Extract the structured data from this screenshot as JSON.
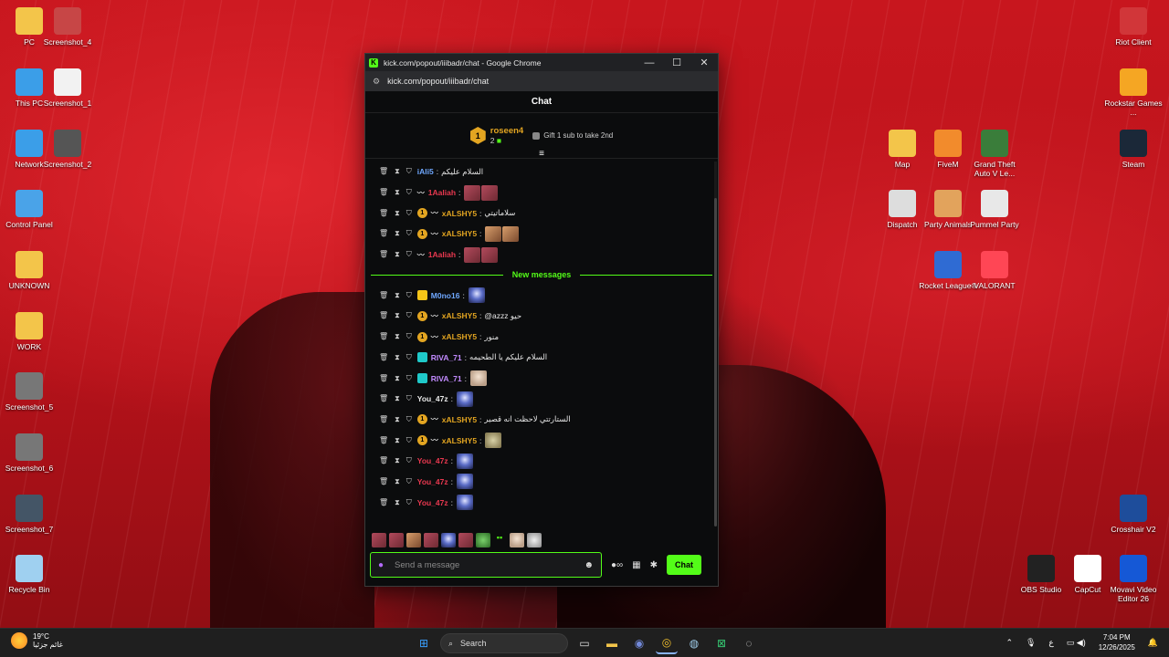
{
  "desktop": {
    "left_icons": [
      {
        "label": "PC",
        "icon": "folder-icon",
        "color": "#f3c54a"
      },
      {
        "label": "Screenshot_4",
        "icon": "image-icon",
        "color": "#c74646"
      },
      {
        "label": "This PC",
        "icon": "monitor-icon",
        "color": "#3b9ee8"
      },
      {
        "label": "Screenshot_1",
        "icon": "document-icon",
        "color": "#f2f2f2"
      },
      {
        "label": "Network",
        "icon": "network-icon",
        "color": "#3b9ee8"
      },
      {
        "label": "Screenshot_2",
        "icon": "image-icon",
        "color": "#555555"
      },
      {
        "label": "Control Panel",
        "icon": "control-panel-icon",
        "color": "#4aa3e8"
      },
      {
        "label": "UNKNOWN",
        "icon": "folder-icon",
        "color": "#f3c54a"
      },
      {
        "label": "WORK",
        "icon": "folder-icon",
        "color": "#f3c54a"
      },
      {
        "label": "Screenshot_5",
        "icon": "image-icon",
        "color": "#777777"
      },
      {
        "label": "Screenshot_6",
        "icon": "image-icon",
        "color": "#777777"
      },
      {
        "label": "Screenshot_7",
        "icon": "image-icon",
        "color": "#445566"
      },
      {
        "label": "Recycle Bin",
        "icon": "recycle-bin-icon",
        "color": "#9fd0f0"
      }
    ],
    "right_icons": [
      {
        "label": "Riot Client",
        "icon": "riot-icon",
        "color": "#d13639"
      },
      {
        "label": "Rockstar Games ...",
        "icon": "rockstar-icon",
        "color": "#f5a623"
      },
      {
        "label": "Steam",
        "icon": "steam-icon",
        "color": "#1b2838"
      },
      {
        "label": "Map",
        "icon": "folder-icon",
        "color": "#f3c54a"
      },
      {
        "label": "FiveM",
        "icon": "fivem-icon",
        "color": "#f28b2c"
      },
      {
        "label": "Grand Theft Auto V Le...",
        "icon": "gta-icon",
        "color": "#3a7d3a"
      },
      {
        "label": "Dispatch",
        "icon": "dispatch-icon",
        "color": "#dddddd"
      },
      {
        "label": "Party Animals",
        "icon": "party-animals-icon",
        "color": "#e2a35c"
      },
      {
        "label": "Pummel Party",
        "icon": "pummel-party-icon",
        "color": "#e8e8e8"
      },
      {
        "label": "Rocket League®",
        "icon": "rocket-league-icon",
        "color": "#2f6bd3"
      },
      {
        "label": "VALORANT",
        "icon": "valorant-icon",
        "color": "#ff4655"
      },
      {
        "label": "Crosshair V2",
        "icon": "crosshair-icon",
        "color": "#1e4d9b"
      },
      {
        "label": "OBS Studio",
        "icon": "obs-icon",
        "color": "#222222"
      },
      {
        "label": "CapCut",
        "icon": "capcut-icon",
        "color": "#ffffff"
      },
      {
        "label": "Movavi Video Editor 26",
        "icon": "movavi-icon",
        "color": "#1558d6"
      }
    ]
  },
  "window": {
    "title": "kick.com/popout/iiibadr/chat - Google Chrome",
    "url": "kick.com/popout/iiibadr/chat",
    "min": "—",
    "max": "☐",
    "close": "✕"
  },
  "chat": {
    "header": "Chat",
    "pinned": {
      "rank": "1",
      "name": "roseen4",
      "count": "2",
      "gift_text": "Gift 1 sub to take 2nd"
    },
    "messages_top": [
      {
        "user": "iAli5",
        "user_color": "#6fa8ff",
        "text": "السلام عليكم",
        "badges": [],
        "emotes": []
      },
      {
        "user": "1Aaliah",
        "user_color": "#e8384f",
        "text": "",
        "badges": [
          "dash"
        ],
        "emotes": [
          "pink",
          "pink"
        ]
      },
      {
        "user": "xALSHY5",
        "user_color": "#e3a521",
        "text": "سلاماتيتي",
        "badges": [
          "gold",
          "dash"
        ],
        "emotes": []
      },
      {
        "user": "xALSHY5",
        "user_color": "#e3a521",
        "text": "",
        "badges": [
          "gold",
          "dash"
        ],
        "emotes": [
          "tan",
          "tan"
        ]
      },
      {
        "user": "1Aaliah",
        "user_color": "#e8384f",
        "text": "",
        "badges": [
          "dash"
        ],
        "emotes": [
          "pink",
          "pink"
        ]
      }
    ],
    "new_messages_label": "New messages",
    "messages_new": [
      {
        "user": "M0no16",
        "user_color": "#6fa8ff",
        "text": "",
        "badges": [
          "yel"
        ],
        "emotes": [
          "cat"
        ]
      },
      {
        "user": "xALSHY5",
        "user_color": "#e3a521",
        "text": "@azzz حيو",
        "badges": [
          "gold",
          "dash"
        ],
        "emotes": []
      },
      {
        "user": "xALSHY5",
        "user_color": "#e3a521",
        "text": "منور",
        "badges": [
          "gold",
          "dash"
        ],
        "emotes": []
      },
      {
        "user": "RIVA_71",
        "user_color": "#c28bff",
        "text": "السلام عليكم يا الطحيمه",
        "badges": [
          "teal"
        ],
        "emotes": []
      },
      {
        "user": "RIVA_71",
        "user_color": "#c28bff",
        "text": "",
        "badges": [
          "teal"
        ],
        "emotes": [
          "beige"
        ]
      },
      {
        "user": "You_47z",
        "user_color": "#e8e8e8",
        "text": "",
        "badges": [],
        "emotes": [
          "cat"
        ]
      },
      {
        "user": "xALSHY5",
        "user_color": "#e3a521",
        "text": "الستارتتي لاحظت انه قصير",
        "badges": [
          "gold",
          "dash"
        ],
        "emotes": []
      },
      {
        "user": "xALSHY5",
        "user_color": "#e3a521",
        "text": "",
        "badges": [
          "gold",
          "dash"
        ],
        "emotes": [
          "frog"
        ]
      },
      {
        "user": "You_47z",
        "user_color": "#e8384f",
        "text": "",
        "badges": [],
        "emotes": [
          "cat"
        ]
      },
      {
        "user": "You_47z",
        "user_color": "#e8384f",
        "text": "",
        "badges": [],
        "emotes": [
          "cat"
        ]
      },
      {
        "user": "You_47z",
        "user_color": "#e8384f",
        "text": "",
        "badges": [],
        "emotes": [
          "cat"
        ]
      }
    ],
    "input_placeholder": "Send a message",
    "send_label": "Chat"
  },
  "taskbar": {
    "temperature": "19°C",
    "weather_text": "غائم جزئيا",
    "search_label": "Search",
    "language": "ع",
    "time": "7:04 PM",
    "date": "12/26/2025"
  },
  "colors": {
    "kick_green": "#53fc18"
  }
}
